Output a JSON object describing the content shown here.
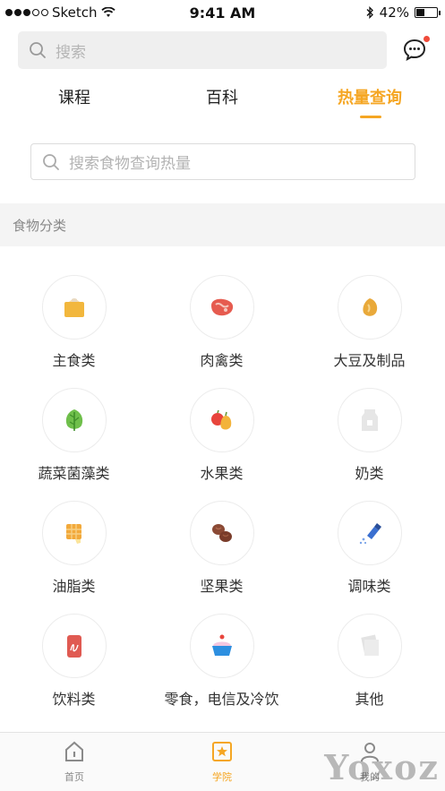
{
  "status_bar": {
    "carrier": "Sketch",
    "time": "9:41 AM",
    "battery": "42%",
    "battery_level": 0.42
  },
  "search": {
    "placeholder": "搜索"
  },
  "tabs": [
    {
      "label": "课程",
      "active": false
    },
    {
      "label": "百科",
      "active": false
    },
    {
      "label": "热量查询",
      "active": true
    }
  ],
  "food_search": {
    "placeholder": "搜索食物查询热量"
  },
  "section": {
    "title": "食物分类"
  },
  "categories": [
    {
      "label": "主食类",
      "icon": "staple-food-icon"
    },
    {
      "label": "肉禽类",
      "icon": "meat-icon"
    },
    {
      "label": "大豆及制品",
      "icon": "soybean-icon"
    },
    {
      "label": "蔬菜菌藻类",
      "icon": "vegetable-icon"
    },
    {
      "label": "水果类",
      "icon": "fruit-icon"
    },
    {
      "label": "奶类",
      "icon": "milk-icon"
    },
    {
      "label": "油脂类",
      "icon": "oil-icon"
    },
    {
      "label": "坚果类",
      "icon": "nut-icon"
    },
    {
      "label": "调味类",
      "icon": "seasoning-icon"
    },
    {
      "label": "饮料类",
      "icon": "beverage-icon"
    },
    {
      "label": "零食，电信及冷饮",
      "icon": "snack-icon"
    },
    {
      "label": "其他",
      "icon": "other-icon"
    }
  ],
  "bottom_nav": [
    {
      "label": "首页",
      "icon": "home-icon",
      "active": false
    },
    {
      "label": "学院",
      "icon": "college-icon",
      "active": true
    },
    {
      "label": "我的",
      "icon": "profile-icon",
      "active": false
    }
  ],
  "watermark": "Yoxoz",
  "colors": {
    "accent": "#f5a623",
    "badge": "#f04b3a"
  }
}
